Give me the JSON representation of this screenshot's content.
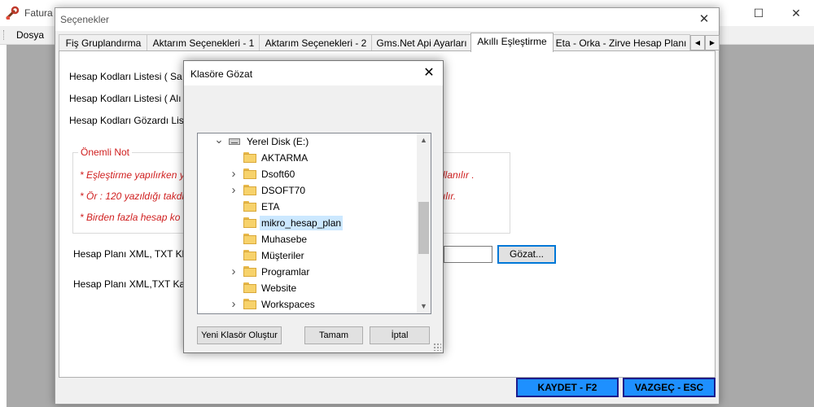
{
  "app": {
    "title": "Fatura (",
    "menu": [
      "Dosya"
    ],
    "icon": "wrench-app-icon"
  },
  "options_dialog": {
    "title": "Seçenekler",
    "tabs": [
      "Fiş Gruplandırma",
      "Aktarım Seçenekleri - 1",
      "Aktarım Seçenekleri - 2",
      "Gms.Net Api Ayarları",
      "Akıllı Eşleştirme",
      "Eta - Orka - Zirve Hesap Planı"
    ],
    "active_tab": "Akıllı Eşleştirme",
    "labels": {
      "line1": "Hesap Kodları Listesi ( Sa",
      "line2": "Hesap Kodları Listesi ( Alı",
      "line3": "Hesap Kodları Gözardı Lis",
      "xml_line": "Hesap Planı XML, TXT Kl",
      "xml_line2": "Hesap Planı XML,TXT Ka"
    },
    "note": {
      "title": "Önemli Not",
      "line1_left": "* Eşleştirme yapılırken y",
      "line1_right": "llanılır .",
      "line2_left": "* Ör : 120 yazıldığı takdi",
      "line2_right": "ılır.",
      "line3_left": "* Birden fazla hesap ko"
    },
    "browse_button": "Gözat...",
    "save_button": "KAYDET - F2",
    "cancel_button": "VAZGEÇ - ESC"
  },
  "browse_dialog": {
    "title": "Klasöre Gözat",
    "tree": [
      {
        "label": "Yerel Disk (E:)",
        "type": "drive",
        "expander": "expanded",
        "level": 0
      },
      {
        "label": "AKTARMA",
        "type": "folder",
        "expander": "none",
        "level": 1
      },
      {
        "label": "Dsoft60",
        "type": "folder",
        "expander": "collapsed",
        "level": 1
      },
      {
        "label": "DSOFT70",
        "type": "folder",
        "expander": "collapsed",
        "level": 1
      },
      {
        "label": "ETA",
        "type": "folder",
        "expander": "none",
        "level": 1
      },
      {
        "label": "mikro_hesap_plan",
        "type": "folder",
        "expander": "none",
        "level": 1,
        "selected": true
      },
      {
        "label": "Muhasebe",
        "type": "folder",
        "expander": "none",
        "level": 1
      },
      {
        "label": "Müşteriler",
        "type": "folder",
        "expander": "none",
        "level": 1
      },
      {
        "label": "Programlar",
        "type": "folder",
        "expander": "collapsed",
        "level": 1
      },
      {
        "label": "Website",
        "type": "folder",
        "expander": "none",
        "level": 1
      },
      {
        "label": "Workspaces",
        "type": "folder",
        "expander": "collapsed",
        "level": 1
      }
    ],
    "buttons": {
      "new_folder": "Yeni Klasör Oluştur",
      "ok": "Tamam",
      "cancel": "İptal"
    }
  },
  "colors": {
    "note_text": "#d02020",
    "footer_button": "#1e90ff",
    "selection": "#cce8ff",
    "folder": "#f7d26b"
  }
}
